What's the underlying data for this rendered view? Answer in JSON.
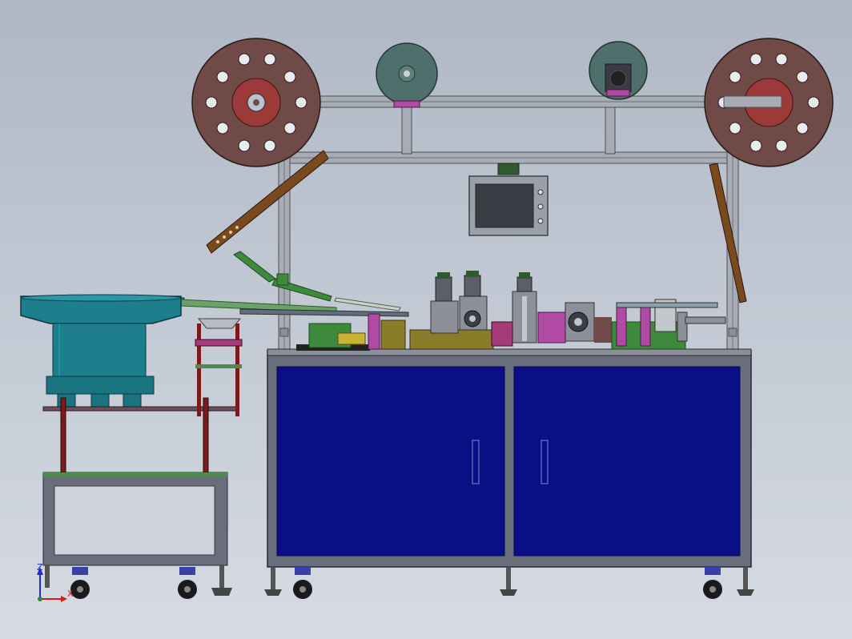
{
  "scene": {
    "title": "",
    "view": "front"
  },
  "triad": {
    "z_label": "Z",
    "x_label": "X"
  },
  "colors": {
    "background_top": "#aeb7c4",
    "background_bottom": "#d6dbe3",
    "cabinet_frame": "#6a6e7c",
    "cabinet_panel": "#0a0f85",
    "reel": "#6f4a47",
    "reel_hub": "#9c3a3a",
    "spool_green": "#4e6f6c",
    "bowl_feeder": "#1d7e8c",
    "profile_frame": "#a8adb5",
    "axis_blue": "#1f2bd6",
    "axis_red": "#d21d1d",
    "axis_green": "#2a8c2a"
  },
  "components": [
    {
      "name": "left-reel-icon"
    },
    {
      "name": "right-reel-icon"
    },
    {
      "name": "center-spool-left-icon"
    },
    {
      "name": "center-spool-right-icon"
    },
    {
      "name": "touch-screen-monitor-icon"
    },
    {
      "name": "vibratory-bowl-feeder-icon"
    },
    {
      "name": "feeder-stand-icon"
    },
    {
      "name": "main-cabinet-icon"
    },
    {
      "name": "caster-wheel-icon"
    }
  ]
}
